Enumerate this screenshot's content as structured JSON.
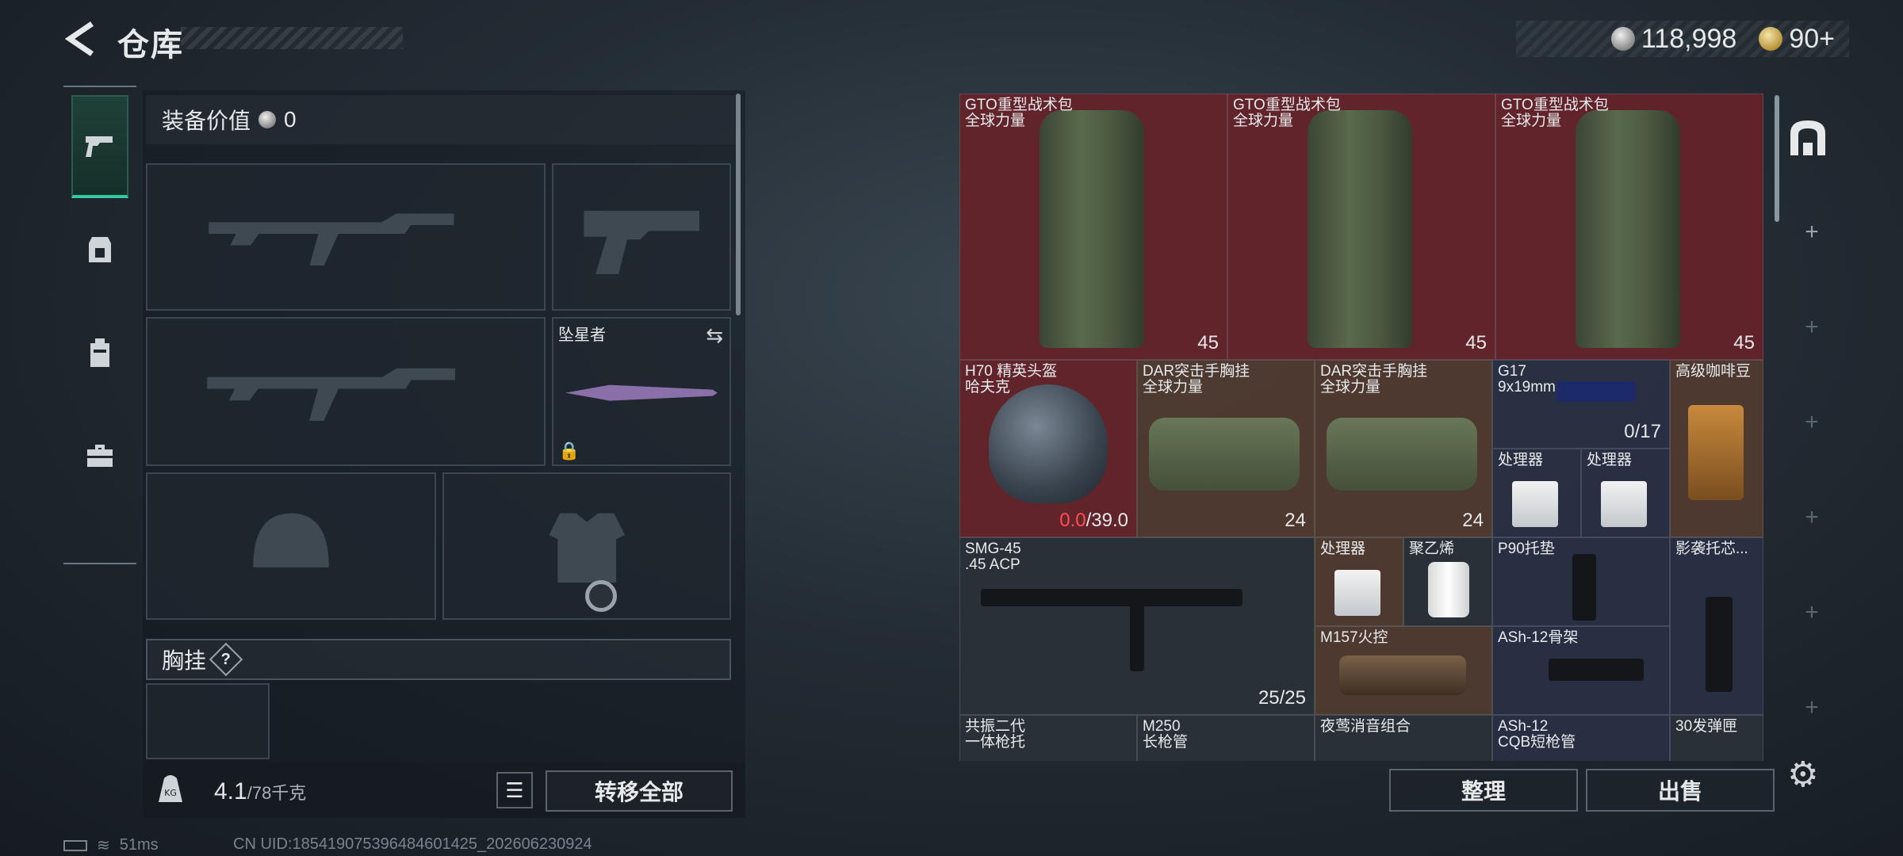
{
  "header": {
    "title": "仓库",
    "silver": "118,998",
    "gold": "90+"
  },
  "equipment": {
    "value_label": "装备价值",
    "value": "0",
    "knife_name": "坠星者",
    "vest_label": "胸挂",
    "help_glyph": "?"
  },
  "footer_left": {
    "weight_current": "4.1",
    "weight_max": "/78千克",
    "transfer_all": "转移全部"
  },
  "status": {
    "ping": "51ms",
    "uid": "CN UID:18541907539648460​1425_202606230924"
  },
  "storage": {
    "items": [
      {
        "name": "GTO重型战术包",
        "sub": "全球力量",
        "qty": "45"
      },
      {
        "name": "GTO重型战术包",
        "sub": "全球力量",
        "qty": "45"
      },
      {
        "name": "GTO重型战术包",
        "sub": "全球力量",
        "qty": "45"
      },
      {
        "name": "H70 精英头盔",
        "sub": "哈夫克",
        "durability_current": "0.0",
        "durability_max": "/39.0"
      },
      {
        "name": "DAR突击手胸挂",
        "sub": "全球力量",
        "qty": "24"
      },
      {
        "name": "DAR突击手胸挂",
        "sub": "全球力量",
        "qty": "24"
      },
      {
        "name": "G17",
        "sub": "9x19mm",
        "qty": "0/17"
      },
      {
        "name": "高级咖啡豆"
      },
      {
        "name": "处理器"
      },
      {
        "name": "处理器"
      },
      {
        "name": "SMG-45",
        "sub": ".45 ACP",
        "qty": "25/25"
      },
      {
        "name": "处理器"
      },
      {
        "name": "聚乙烯"
      },
      {
        "name": "P90托垫"
      },
      {
        "name": "影袭托芯..."
      },
      {
        "name": "M157火控"
      },
      {
        "name": "ASh-12骨架"
      },
      {
        "name": "共振二代",
        "sub": "一体枪托"
      },
      {
        "name": "M250",
        "sub": "长枪管"
      },
      {
        "name": "夜莺消音组合"
      },
      {
        "name": "ASh-12",
        "sub": "CQB短枪管"
      },
      {
        "name": "30发弹匣"
      }
    ],
    "sort_label": "整理",
    "sell_label": "出售"
  },
  "colors": {
    "accent": "#36c8a0",
    "rare_red": "#6e242c",
    "durability_low": "#ff4e4e"
  }
}
